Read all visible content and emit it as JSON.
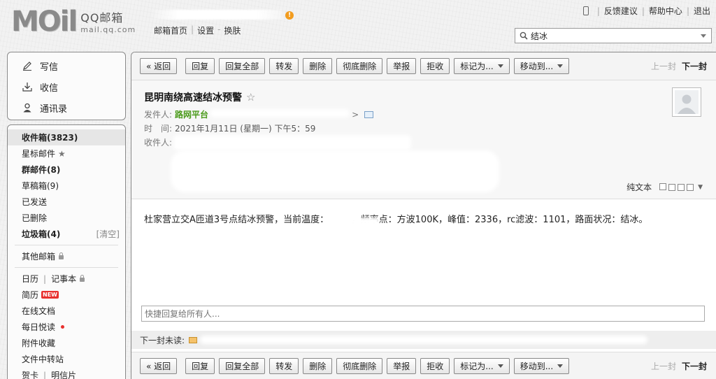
{
  "header": {
    "logo_mark": "MOil",
    "logo_name": "QQ邮箱",
    "logo_domain": "mail.qq.com",
    "alert_glyph": "!",
    "links": [
      "邮箱首页",
      "设置",
      "换肤"
    ],
    "link_sep_1": "|",
    "link_sep_2": "-",
    "user_links": [
      "反馈建议",
      "帮助中心",
      "退出"
    ],
    "search_value": "结冰"
  },
  "sidebar": {
    "actions": [
      {
        "label": "写信",
        "icon": "pen-icon"
      },
      {
        "label": "收信",
        "icon": "inbox-download-icon"
      },
      {
        "label": "通讯录",
        "icon": "contacts-icon"
      }
    ],
    "folders": {
      "inbox": "收件箱(3823)",
      "starred": "星标邮件",
      "groups": "群邮件(8)",
      "drafts": "草稿箱(9)",
      "sent": "已发送",
      "deleted": "已删除",
      "spam": "垃圾箱(4)",
      "spam_clear": "[清空]",
      "other_mailbox": "其他邮箱",
      "calendar": "日历",
      "notebook": "记事本",
      "resume": "简历",
      "new_badge": "NEW",
      "online_docs": "在线文档",
      "daily_read": "每日悦读",
      "attachments": "附件收藏",
      "file_transfer": "文件中转站",
      "cards": "贺卡",
      "postcards": "明信片"
    }
  },
  "toolbar": {
    "back": "« 返回",
    "reply": "回复",
    "reply_all": "回复全部",
    "forward": "转发",
    "delete": "删除",
    "delete_forever": "彻底删除",
    "report": "举报",
    "reject": "拒收",
    "mark_as": "标记为...",
    "move_to": "移动到...",
    "prev_mail": "上一封",
    "next_mail": "下一封"
  },
  "mail": {
    "subject": "昆明南绕高速结冰预警",
    "star_glyph": "☆",
    "from_label": "发件人:",
    "from_name": "路网平台",
    "from_suffix": ">",
    "time_label": "时　间:",
    "time_value": "2021年1月11日 (星期一) 下午5：59",
    "to_label": "收件人:",
    "plain_text": "纯文本",
    "body": "杜家营立交A匝道3号点结冰预警，当前温度：　　　，频率点：方波100K，峰值：2336，rc滤波：1101，路面状况：结冰。",
    "quick_reply_placeholder": "快捷回复给所有人...",
    "next_unread_label": "下一封未读:"
  },
  "colors": {
    "sender_green": "#4a9a1a",
    "badge_red": "#e8302e",
    "alert_orange": "#f29c1f"
  }
}
